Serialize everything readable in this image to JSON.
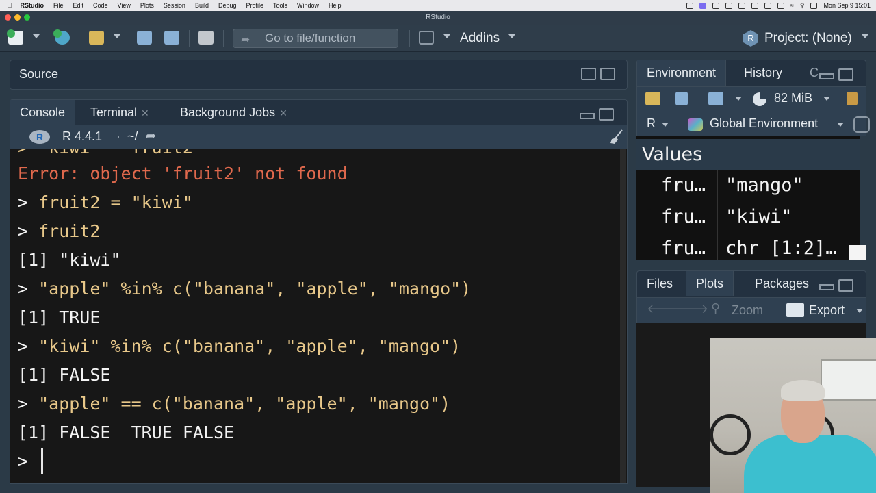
{
  "menubar": {
    "app": "RStudio",
    "items": [
      "File",
      "Edit",
      "Code",
      "View",
      "Plots",
      "Session",
      "Build",
      "Debug",
      "Profile",
      "Tools",
      "Window",
      "Help"
    ],
    "clock": "Mon Sep 9  15:01"
  },
  "window": {
    "title": "RStudio"
  },
  "toolbar": {
    "goto_placeholder": "Go to file/function",
    "addins_label": "Addins",
    "project_label": "Project: (None)"
  },
  "source": {
    "label": "Source"
  },
  "console": {
    "tabs": [
      {
        "label": "Console"
      },
      {
        "label": "Terminal"
      },
      {
        "label": "Background Jobs"
      }
    ],
    "r_version": "R 4.4.1",
    "dot": "·",
    "working_dir": "~/",
    "lines": [
      {
        "kind": "err",
        "text": "Error: object 'fruit2' not found"
      },
      {
        "kind": "in",
        "prompt": "> ",
        "text": "fruit2 = \"kiwi\""
      },
      {
        "kind": "in",
        "prompt": "> ",
        "text": "fruit2"
      },
      {
        "kind": "out",
        "text": "[1] \"kiwi\""
      },
      {
        "kind": "in",
        "prompt": "> ",
        "text": "\"apple\" %in% c(\"banana\", \"apple\", \"mango\")"
      },
      {
        "kind": "out",
        "text": "[1] TRUE"
      },
      {
        "kind": "in",
        "prompt": "> ",
        "text": "\"kiwi\" %in% c(\"banana\", \"apple\", \"mango\")"
      },
      {
        "kind": "out",
        "text": "[1] FALSE"
      },
      {
        "kind": "in",
        "prompt": "> ",
        "text": "\"apple\" == c(\"banana\", \"apple\", \"mango\")"
      },
      {
        "kind": "out",
        "text": "[1] FALSE  TRUE FALSE"
      }
    ],
    "current_prompt": ">"
  },
  "environment": {
    "tabs": [
      "Environment",
      "History"
    ],
    "memory": "82 MiB",
    "language": "R",
    "scope": "Global Environment",
    "section": "Values",
    "values": [
      {
        "name": "fru…",
        "value": "\"mango\""
      },
      {
        "name": "fru…",
        "value": "\"kiwi\""
      },
      {
        "name": "fru…",
        "value": "chr [1:2]…"
      }
    ]
  },
  "files": {
    "tabs": [
      "Files",
      "Plots",
      "Packages"
    ],
    "zoom_label": "Zoom",
    "export_label": "Export"
  },
  "colors": {
    "error": "#e0694d",
    "input": "#e8c88a",
    "output": "#f3f3f3",
    "console_bg": "#171717",
    "pane_header": "#233140"
  }
}
